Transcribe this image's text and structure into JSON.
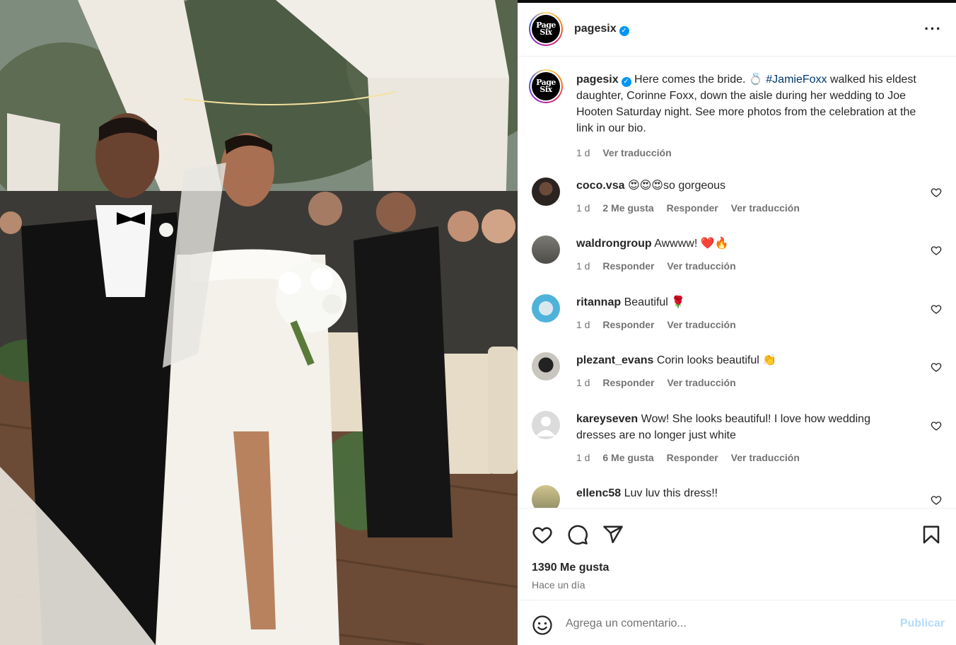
{
  "post": {
    "account": "pagesix",
    "avatar_text_line1": "Page",
    "avatar_text_line2": "Six",
    "verified": true,
    "more_icon": "more-horizontal-icon",
    "caption_prefix": "Here comes the bride. 💍 ",
    "caption_hashtag": "#JamieFoxx",
    "caption_rest": " walked his eldest daughter, Corinne Foxx, down the aisle during her wedding to Joe Hooten Saturday night. See more photos from the celebration at the link in our bio.",
    "caption_age": "1 d",
    "translate_label": "Ver traducción"
  },
  "comments": [
    {
      "user": "coco.vsa",
      "text": "😍😍😍so gorgeous",
      "age": "1 d",
      "likes": "2 Me gusta",
      "reply": "Responder",
      "translate": "Ver traducción"
    },
    {
      "user": "waldrongroup",
      "text": "Awwww! ❤️🔥",
      "age": "1 d",
      "likes": "",
      "reply": "Responder",
      "translate": "Ver traducción"
    },
    {
      "user": "ritannap",
      "text": "Beautiful 🌹",
      "age": "1 d",
      "likes": "",
      "reply": "Responder",
      "translate": "Ver traducción"
    },
    {
      "user": "plezant_evans",
      "text": "Corin looks beautiful 👏",
      "age": "1 d",
      "likes": "",
      "reply": "Responder",
      "translate": "Ver traducción"
    },
    {
      "user": "kareyseven",
      "text": "Wow! She looks beautiful! I love how wedding dresses are no longer just white",
      "age": "1 d",
      "likes": "6 Me gusta",
      "reply": "Responder",
      "translate": "Ver traducción"
    },
    {
      "user": "ellenc58",
      "text": "Luv luv this dress!!",
      "age": "",
      "likes": "",
      "reply": "",
      "translate": ""
    }
  ],
  "actions": {
    "like_icon": "heart-icon",
    "comment_icon": "comment-icon",
    "share_icon": "send-icon",
    "save_icon": "bookmark-icon"
  },
  "stats": {
    "likes": "1390 Me gusta",
    "posted": "Hace un día"
  },
  "composer": {
    "emoji_icon": "emoji-icon",
    "placeholder": "Agrega un comentario...",
    "publish_label": "Publicar"
  },
  "colors": {
    "link": "#00376b",
    "secondary_text": "#737373",
    "publish_disabled": "#b3dbff",
    "verified": "#0095f6"
  }
}
